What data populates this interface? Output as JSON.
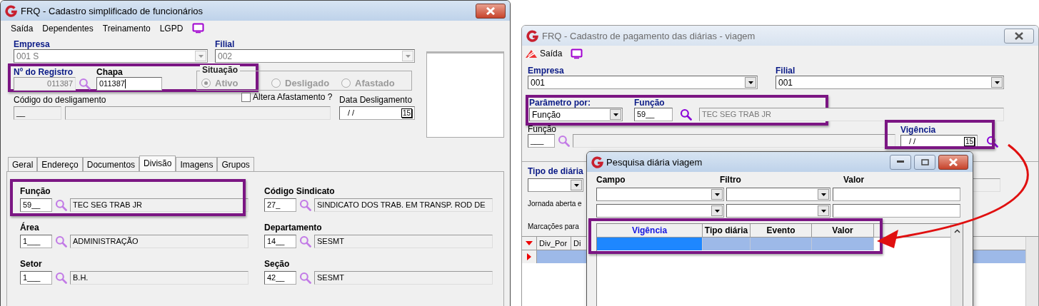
{
  "left_window": {
    "title": "FRQ - Cadastro simplificado de funcionários",
    "active": true,
    "menu": [
      {
        "label": "Saída"
      },
      {
        "label": "Dependentes"
      },
      {
        "label": "Treinamento"
      },
      {
        "label": "LGPD"
      }
    ],
    "empresa": {
      "label": "Empresa",
      "value": "001 S"
    },
    "filial": {
      "label": "Filial",
      "value": "002"
    },
    "id_row": {
      "highlighted": true,
      "registro": {
        "label": "Nº do Registro",
        "value": "011387"
      },
      "chapa": {
        "label": "Chapa",
        "value": "011387"
      },
      "situacao": {
        "label": "Situação",
        "options": [
          {
            "label": "Ativo",
            "selected": true
          },
          {
            "label": "Desligado",
            "selected": false
          },
          {
            "label": "Afastado",
            "selected": false
          }
        ]
      }
    },
    "codigo_desligamento": {
      "label": "Código do desligamento",
      "code": "__"
    },
    "altera_afastamento": {
      "label": "Altera Afastamento ?",
      "checked": false
    },
    "data_desligamento": {
      "label": "Data Desligamento",
      "value": "/ /",
      "calendar": "15"
    },
    "tabs": [
      {
        "label": "Geral",
        "selected": false
      },
      {
        "label": "Endereço",
        "selected": false
      },
      {
        "label": "Documentos",
        "selected": false
      },
      {
        "label": "Divisão",
        "selected": true
      },
      {
        "label": "Imagens",
        "selected": false
      },
      {
        "label": "Grupos",
        "selected": false
      }
    ],
    "fields": [
      {
        "label": "Função",
        "code": "59__",
        "description": "TEC SEG TRAB JR",
        "highlighted": true
      },
      {
        "label": "Código Sindicato",
        "code": "27_",
        "description": "SINDICATO DOS TRAB. EM TRANSP. ROD DE",
        "highlighted": false
      },
      {
        "label": "Área",
        "code": "1___",
        "description": "ADMINISTRAÇÃO",
        "highlighted": false
      },
      {
        "label": "Departamento",
        "code": "14__",
        "description": "SESMT",
        "highlighted": false
      },
      {
        "label": "Setor",
        "code": "1___",
        "description": "B.H.",
        "highlighted": false
      },
      {
        "label": "Seção",
        "code": "42__",
        "description": "SESMT",
        "highlighted": false
      }
    ]
  },
  "right_window": {
    "title": "FRQ - Cadastro de pagamento das diárias - viagem",
    "active": false,
    "toolbar": [
      {
        "label": "Saída"
      }
    ],
    "empresa": {
      "label": "Empresa",
      "value": "001"
    },
    "filial": {
      "label": "Filial",
      "value": "001"
    },
    "param_row": {
      "highlighted": true,
      "parametro": {
        "label": "Parâmetro por:",
        "value": "Função"
      },
      "funcao": {
        "label": "Função",
        "code": "59__",
        "description": "TEC SEG TRAB JR"
      }
    },
    "funcao_filtro": {
      "label": "Função",
      "code": "___"
    },
    "vigencia": {
      "label": "Vigência",
      "value": "/ /",
      "calendar": "15",
      "highlighted": true
    },
    "tipo_diaria": {
      "label": "Tipo de diária"
    },
    "jornada": "Jornada aberta e",
    "marcacoes": "Marcações para",
    "grid": {
      "columns": [
        "Div_Por",
        "Di"
      ],
      "rows": [
        {
          "selected": true
        }
      ]
    }
  },
  "search_dialog": {
    "title": "Pesquisa diária viagem",
    "filter_labels": [
      "Campo",
      "Filtro",
      "Valor"
    ],
    "results": {
      "highlighted": true,
      "columns": [
        {
          "label": "Vigência",
          "sorted": true
        },
        {
          "label": "Tipo diária",
          "sorted": false
        },
        {
          "label": "Evento",
          "sorted": false
        },
        {
          "label": "Valor",
          "sorted": false
        }
      ],
      "rows": [
        {
          "selected": true
        }
      ]
    }
  }
}
